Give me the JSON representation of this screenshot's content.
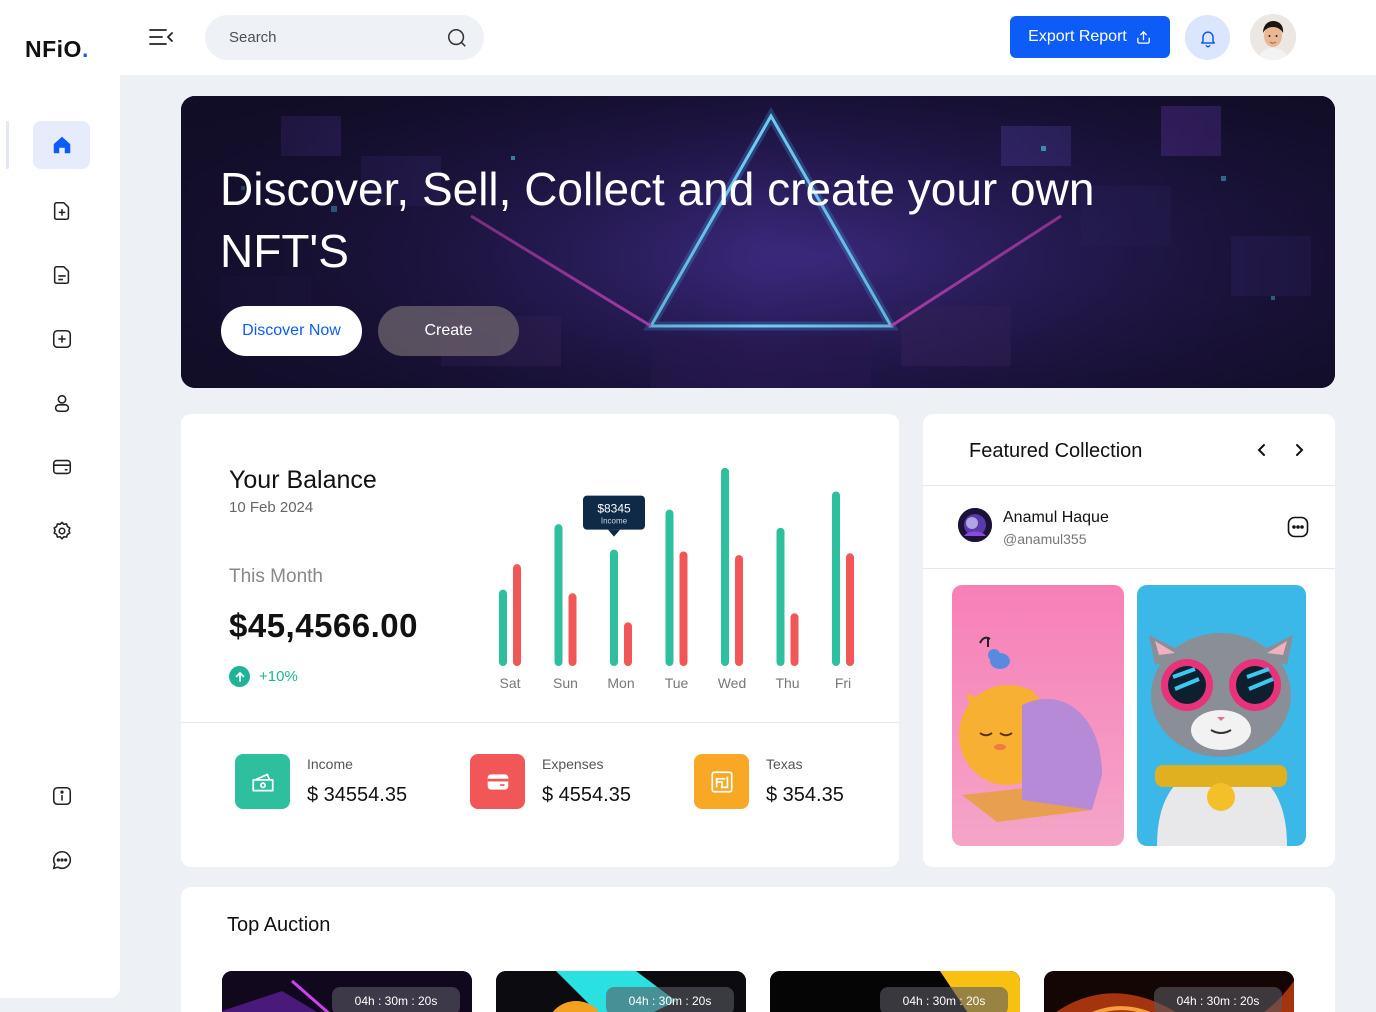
{
  "brand": {
    "logo_text": "NFiO",
    "logo_dot": ".",
    "accent": "#0d5cf7"
  },
  "sidebar": {
    "items": [
      {
        "name": "home",
        "icon": "home-icon",
        "active": true
      },
      {
        "name": "add-file",
        "icon": "file-plus-icon"
      },
      {
        "name": "document",
        "icon": "file-text-icon"
      },
      {
        "name": "create",
        "icon": "plus-square-icon"
      },
      {
        "name": "profile",
        "icon": "user-icon"
      },
      {
        "name": "wallet",
        "icon": "wallet-icon"
      },
      {
        "name": "settings",
        "icon": "gear-icon"
      }
    ],
    "bottom": [
      {
        "name": "info",
        "icon": "info-icon"
      },
      {
        "name": "chat",
        "icon": "chat-icon"
      }
    ]
  },
  "topbar": {
    "search_placeholder": "Search",
    "export_label": "Export Report"
  },
  "hero": {
    "title": "Discover, Sell, Collect and create your own NFT'S",
    "discover_label": "Discover Now",
    "create_label": "Create"
  },
  "balance": {
    "title": "Your Balance",
    "date": "10 Feb 2024",
    "month_label": "This Month",
    "amount": "$45,4566.00",
    "change": "+10%",
    "stats": [
      {
        "label": "Income",
        "value": "$ 34554.35",
        "color": "#2ebf9f"
      },
      {
        "label": "Expenses",
        "value": "$ 4554.35",
        "color": "#f25757"
      },
      {
        "label": "Texas",
        "value": "$ 354.35",
        "color": "#f9a825"
      }
    ]
  },
  "chart_data": {
    "type": "bar",
    "categories": [
      "Sat",
      "Sun",
      "Mon",
      "Tue",
      "Wed",
      "Thu",
      "Fri"
    ],
    "series": [
      {
        "name": "Income",
        "color": "#2ebf9f",
        "values": [
          4200,
          7800,
          6400,
          8600,
          10900,
          7600,
          9600
        ]
      },
      {
        "color": "#f25757",
        "values": [
          5600,
          4000,
          2400,
          6300,
          6100,
          2900,
          6200
        ]
      }
    ],
    "tooltip": {
      "category": "Mon",
      "value": "$8345",
      "label": "Income"
    }
  },
  "featured": {
    "title": "Featured Collection",
    "user_name": "Anamul Haque",
    "user_handle": "@anamul355"
  },
  "auction": {
    "title": "Top Auction",
    "cards": [
      {
        "timer": "04h : 30m : 20s"
      },
      {
        "timer": "04h : 30m : 20s"
      },
      {
        "timer": "04h : 30m : 20s"
      },
      {
        "timer": "04h : 30m : 20s"
      }
    ]
  }
}
